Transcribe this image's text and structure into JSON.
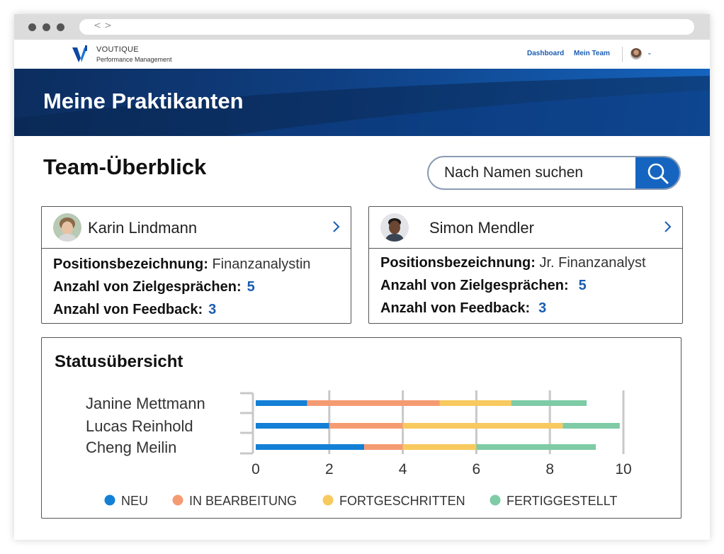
{
  "browser": {
    "nav_glyph": "< >"
  },
  "header": {
    "brand": "VOUTIQUE",
    "tagline": "Performance Management",
    "nav": [
      {
        "label": "Dashboard"
      },
      {
        "label": "Mein Team"
      }
    ]
  },
  "banner": {
    "title": "Meine Praktikanten"
  },
  "overview": {
    "title": "Team-Überblick",
    "search": {
      "placeholder": "Nach Namen suchen"
    }
  },
  "cards": [
    {
      "name": "Karin Lindmann",
      "position_label": "Positionsbezeichnung:",
      "position": "Finanzanalystin",
      "talks_label": "Anzahl von Zielgesprächen:",
      "talks": "5",
      "feedback_label": "Anzahl von Feedback:",
      "feedback": "3"
    },
    {
      "name": "Simon Mendler",
      "position_label": "Positionsbezeichnung:",
      "position": "Jr. Finanzanalyst",
      "talks_label": "Anzahl von Zielgesprächen:",
      "talks": "5",
      "feedback_label": "Anzahl von Feedback:",
      "feedback": "3"
    }
  ],
  "status": {
    "title": "Statusübersicht"
  },
  "colors": {
    "brand_blue": "#1565c0",
    "link_blue": "#1a5cb0"
  },
  "chart_data": {
    "type": "bar",
    "orientation": "horizontal",
    "stacked": true,
    "categories": [
      "Janine Mettmann",
      "Lucas Reinhold",
      "Cheng Meilin"
    ],
    "series": [
      {
        "name": "NEU",
        "color": "#1380d6",
        "values": [
          1.4,
          2.0,
          2.95
        ]
      },
      {
        "name": "IN BEARBEITUNG",
        "color": "#f59b72",
        "values": [
          3.6,
          2.0,
          1.05
        ]
      },
      {
        "name": "FORTGESCHRITTEN",
        "color": "#f8c95e",
        "values": [
          1.95,
          4.35,
          2.0
        ]
      },
      {
        "name": "FERTIGGESTELLT",
        "color": "#7ecba6",
        "values": [
          2.05,
          1.55,
          3.25
        ]
      }
    ],
    "xlim": [
      0,
      10
    ],
    "xticks": [
      "0",
      "2",
      "4",
      "6",
      "8",
      "10"
    ],
    "grid": true,
    "legend": "bottom"
  }
}
